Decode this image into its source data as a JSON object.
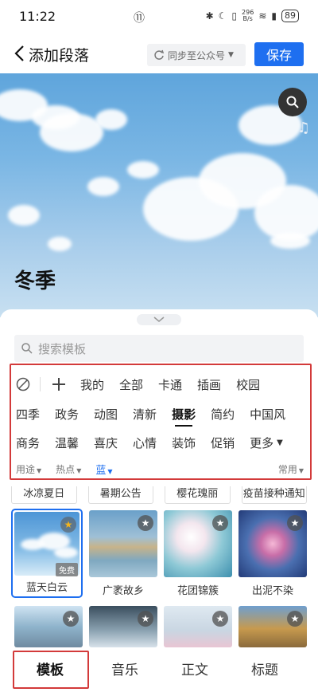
{
  "status": {
    "time": "11:22",
    "speed_top": "296",
    "speed_bottom": "B/s",
    "battery": "89"
  },
  "header": {
    "title": "添加段落",
    "sync_label": "同步至公众号",
    "save_label": "保存"
  },
  "hero": {
    "title": "冬季"
  },
  "search": {
    "placeholder": "搜索模板"
  },
  "filters": {
    "row1": [
      "我的",
      "全部",
      "卡通",
      "插画",
      "校园"
    ],
    "row2": [
      "四季",
      "政务",
      "动图",
      "清新",
      "摄影",
      "简约",
      "中国风"
    ],
    "row3": [
      "商务",
      "温馨",
      "喜庆",
      "心情",
      "装饰",
      "促销",
      "更多"
    ],
    "usage": "用途",
    "hot": "热点",
    "color": "蓝",
    "common": "常用"
  },
  "presets": [
    "冰凉夏日",
    "暑期公告",
    "樱花瑰丽",
    "疫苗接种通知"
  ],
  "cards": [
    {
      "label": "蓝天白云",
      "badge": "免费"
    },
    {
      "label": "广袤故乡"
    },
    {
      "label": "花团锦簇"
    },
    {
      "label": "出泥不染"
    }
  ],
  "tabs": [
    "模板",
    "音乐",
    "正文",
    "标题"
  ],
  "colors": {
    "accent": "#1e6ff0",
    "highlight_box": "#d33a3a"
  }
}
